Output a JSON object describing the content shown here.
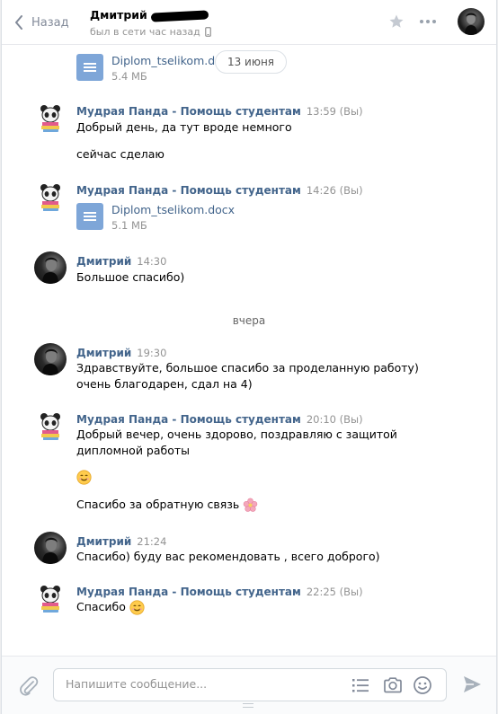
{
  "header": {
    "back_label": "Назад",
    "peer_name": "Дмитрий",
    "peer_status": "был в сети час назад"
  },
  "messages": {
    "top_doc": {
      "name": "Diplom_tselikom.docx",
      "size": "5.4 МБ"
    },
    "date_pill": "13 июня",
    "m1": {
      "author": "Мудрая Панда - Помощь студентам",
      "time": "13:59 (Вы)",
      "line1": "Добрый день, да тут вроде немного",
      "line2": "сейчас сделаю"
    },
    "m2": {
      "author": "Мудрая Панда - Помощь студентам",
      "time": "14:26 (Вы)",
      "doc_name": "Diplom_tselikom.docx",
      "doc_size": "5.1 МБ"
    },
    "m3": {
      "author": "Дмитрий",
      "time": "14:30",
      "line1": "Большое спасибо)"
    },
    "date_separator": "вчера",
    "m4": {
      "author": "Дмитрий",
      "time": "19:30",
      "line1": "Здравствуйте, большое спасибо за проделанную работу)",
      "line2": "очень благодарен, сдал на 4)"
    },
    "m5": {
      "author": "Мудрая Панда - Помощь студентам",
      "time": "20:10 (Вы)",
      "line1": "Добрый вечер, очень здорово, поздравляю с защитой",
      "line2": "дипломной работы",
      "line3": "Спасибо за обратную связь"
    },
    "m6": {
      "author": "Дмитрий",
      "time": "21:24",
      "line1": "Спасибо) буду вас рекомендовать , всего доброго)"
    },
    "m7": {
      "author": "Мудрая Панда - Помощь студентам",
      "time": "22:25 (Вы)",
      "line1": "Спасибо"
    }
  },
  "composer": {
    "placeholder": "Напишите сообщение..."
  },
  "icons": {
    "back": "chevron-left-icon",
    "star": "star-icon",
    "more": "more-dots-icon",
    "attach": "paperclip-icon",
    "format": "list-format-icon",
    "camera": "camera-icon",
    "smile": "smile-icon",
    "send": "send-icon"
  },
  "colors": {
    "link": "#42648b",
    "muted": "#939393",
    "doc": "#7ea6d8"
  }
}
